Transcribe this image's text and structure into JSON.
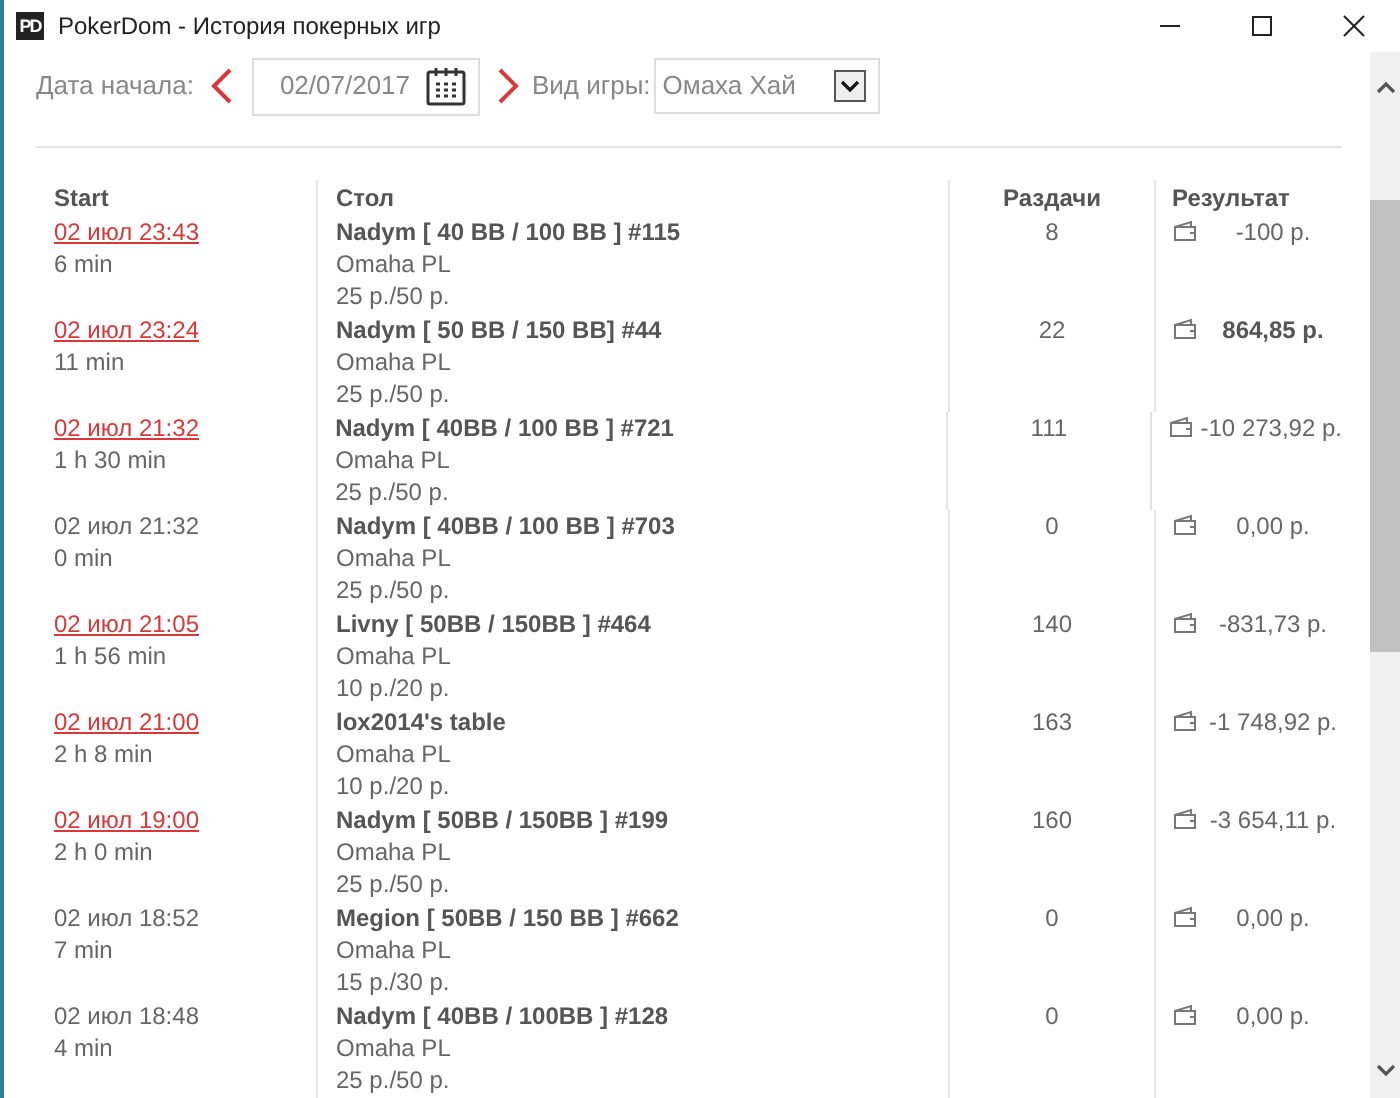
{
  "window": {
    "title": "PokerDom - История покерных игр",
    "logo": "PD"
  },
  "filters": {
    "date_label": "Дата начала:",
    "date_value": "02/07/2017",
    "game_label": "Вид игры:",
    "game_value": "Омаха Хай"
  },
  "table": {
    "columns": [
      "Start",
      "Стол",
      "Раздачи",
      "Результат"
    ],
    "rows": [
      {
        "start": "02 июл 23:43",
        "linked": true,
        "duration": "6 min",
        "table": "Nadym [ 40 BB / 100 BB ] #115",
        "game": "Omaha PL",
        "stakes": "25 р./50 р.",
        "hands": "8",
        "result": "-100 р.",
        "bold": false
      },
      {
        "start": "02 июл 23:24",
        "linked": true,
        "duration": "11 min",
        "table": "Nadym [ 50 BB / 150 BB] #44",
        "game": "Omaha PL",
        "stakes": "25 р./50 р.",
        "hands": "22",
        "result": "864,85 р.",
        "bold": true
      },
      {
        "start": "02 июл 21:32",
        "linked": true,
        "duration": "1 h 30 min",
        "table": "Nadym [ 40BB / 100 BB ] #721",
        "game": "Omaha PL",
        "stakes": "25 р./50 р.",
        "hands": "111",
        "result": "-10 273,92 р.",
        "bold": false
      },
      {
        "start": "02 июл 21:32",
        "linked": false,
        "duration": "0 min",
        "table": "Nadym [ 40BB / 100 BB ] #703",
        "game": "Omaha PL",
        "stakes": "25 р./50 р.",
        "hands": "0",
        "result": "0,00 р.",
        "bold": false
      },
      {
        "start": "02 июл 21:05",
        "linked": true,
        "duration": "1 h 56 min",
        "table": "Livny [ 50BB / 150BB ] #464",
        "game": "Omaha PL",
        "stakes": "10 р./20 р.",
        "hands": "140",
        "result": "-831,73 р.",
        "bold": false
      },
      {
        "start": "02 июл 21:00",
        "linked": true,
        "duration": "2 h 8 min",
        "table": "lox2014's table",
        "game": "Omaha PL",
        "stakes": "10 р./20 р.",
        "hands": "163",
        "result": "-1 748,92 р.",
        "bold": false
      },
      {
        "start": "02 июл 19:00",
        "linked": true,
        "duration": "2 h 0 min",
        "table": "Nadym [ 50BB / 150BB ] #199",
        "game": "Omaha PL",
        "stakes": "25 р./50 р.",
        "hands": "160",
        "result": "-3 654,11 р.",
        "bold": false
      },
      {
        "start": "02 июл 18:52",
        "linked": false,
        "duration": "7 min",
        "table": "Megion [ 50BB / 150 BB ] #662",
        "game": "Omaha PL",
        "stakes": "15 р./30 р.",
        "hands": "0",
        "result": "0,00 р.",
        "bold": false
      },
      {
        "start": "02 июл 18:48",
        "linked": false,
        "duration": "4 min",
        "table": "Nadym [ 40BB / 100BB ] #128",
        "game": "Omaha PL",
        "stakes": "25 р./50 р.",
        "hands": "0",
        "result": "0,00 р.",
        "bold": false
      }
    ]
  }
}
